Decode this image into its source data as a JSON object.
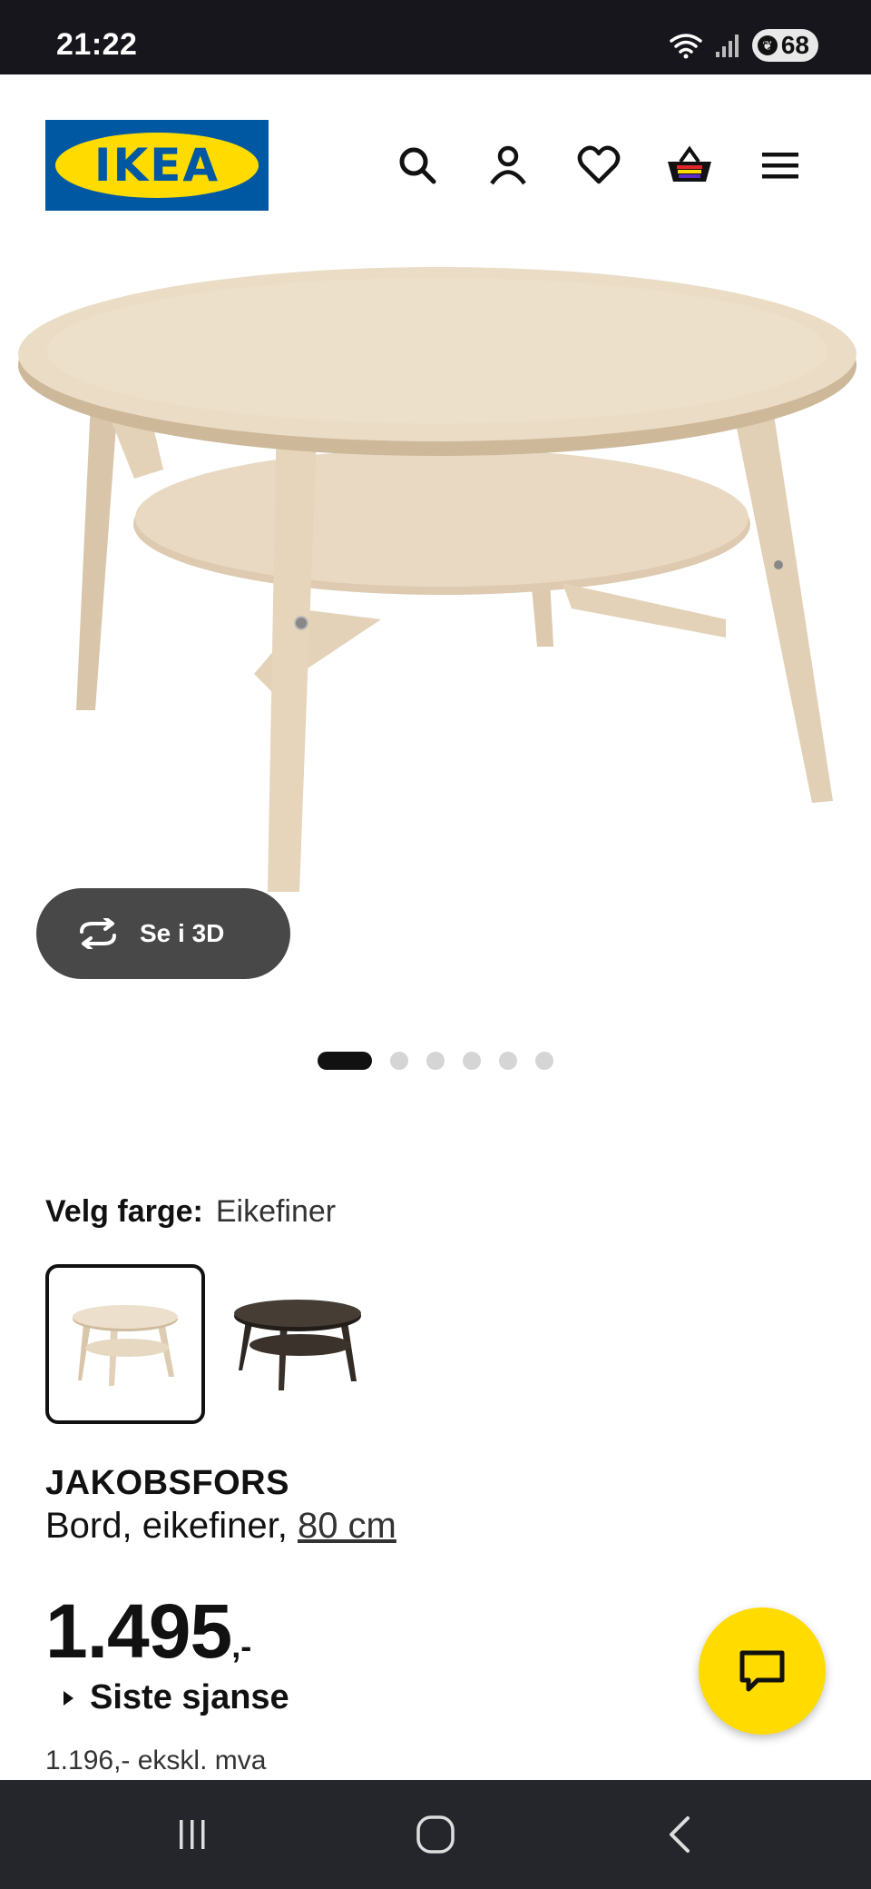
{
  "status_bar": {
    "time": "21:22",
    "battery": "68",
    "icons": [
      "wifi-icon",
      "signal-icon",
      "battery-icon"
    ]
  },
  "header": {
    "logo_text": "IKEA",
    "icons": [
      "search-icon",
      "account-icon",
      "heart-icon",
      "basket-icon",
      "menu-icon"
    ]
  },
  "gallery": {
    "view_3d_label": "Se i 3D",
    "dot_count": 6,
    "active_dot": 0
  },
  "color": {
    "label": "Velg farge:",
    "selected_value": "Eikefiner",
    "options": [
      "light-oak-table-swatch",
      "dark-brown-table-swatch"
    ]
  },
  "product": {
    "name": "JAKOBSFORS",
    "description": "Bord, eikefiner,",
    "size_link": "80 cm",
    "price": "1.495",
    "price_suffix": ",-",
    "last_chance": "Siste sjanse",
    "price_ex_vat": "1.196,- ekskl. mva"
  },
  "colors": {
    "ikea_blue": "#0058a3",
    "ikea_yellow": "#ffdb00",
    "wood_light": "#e8d8c0",
    "wood_dark": "#3d352e"
  }
}
